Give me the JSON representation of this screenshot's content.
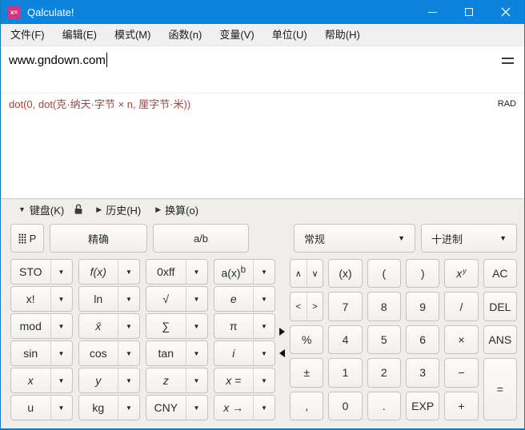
{
  "window": {
    "title": "Qalculate!",
    "titlebar_color": "#0c83dc",
    "border_color": "#1879c0"
  },
  "icons": {
    "app_glyph": "x=",
    "dropdown": "▼",
    "triangle_down": "▼",
    "triangle_right": "▶"
  },
  "menu": {
    "items": [
      {
        "n": "file",
        "label": "文件(F)"
      },
      {
        "n": "edit",
        "label": "编辑(E)"
      },
      {
        "n": "mode",
        "label": "模式(M)"
      },
      {
        "n": "functions",
        "label": "函数(n)"
      },
      {
        "n": "variables",
        "label": "变量(V)"
      },
      {
        "n": "units",
        "label": "单位(U)"
      },
      {
        "n": "help",
        "label": "帮助(H)"
      }
    ]
  },
  "input": {
    "value": "www.gndown.com"
  },
  "status": {
    "parsed": "dot(0, dot(克·纳天·字节 × n, 厘字节·米))",
    "parsed_color": "#a9423d",
    "angle_mode": "RAD"
  },
  "panels": {
    "keyboard": "键盘(K)",
    "history": "历史(H)",
    "convert": "换算(o)"
  },
  "toolbar": {
    "programming": "P",
    "exact": "精确",
    "fraction": "a/b",
    "display_mode": "常规",
    "number_base": "十进制"
  },
  "keypad": {
    "left": [
      [
        {
          "n": "sto",
          "l": "STO"
        },
        {
          "n": "f-of-x",
          "l": "f(x)",
          "i": 1
        },
        {
          "n": "0xff",
          "l": "0xff"
        },
        {
          "n": "a-x-pow-b",
          "l": "a(x)",
          "sup": "b"
        }
      ],
      [
        {
          "n": "factorial",
          "l": "x!"
        },
        {
          "n": "ln",
          "l": "ln"
        },
        {
          "n": "sqrt",
          "l": "√"
        },
        {
          "n": "euler-e",
          "l": "e",
          "i": 1
        }
      ],
      [
        {
          "n": "mod",
          "l": "mod"
        },
        {
          "n": "mean",
          "l": "x̄",
          "i": 1
        },
        {
          "n": "sum",
          "l": "∑"
        },
        {
          "n": "pi",
          "l": "π"
        }
      ],
      [
        {
          "n": "sin",
          "l": "sin"
        },
        {
          "n": "cos",
          "l": "cos"
        },
        {
          "n": "tan",
          "l": "tan"
        },
        {
          "n": "imaginary-i",
          "l": "i",
          "i": 1
        }
      ],
      [
        {
          "n": "var-x",
          "l": "x",
          "i": 1
        },
        {
          "n": "var-y",
          "l": "y",
          "i": 1
        },
        {
          "n": "var-z",
          "l": "z",
          "i": 1
        },
        {
          "n": "x-equals",
          "l": "x =",
          "i": 1
        }
      ],
      [
        {
          "n": "unit-u",
          "l": "u"
        },
        {
          "n": "unit-kg",
          "l": "kg"
        },
        {
          "n": "currency-cny",
          "l": "CNY"
        },
        {
          "n": "x-to",
          "l": "x →",
          "i": 1
        }
      ]
    ],
    "nav": {
      "up": "∧",
      "down": "∨",
      "left": "<",
      "right": ">"
    },
    "right": [
      [
        {
          "nav": "ud"
        },
        {
          "n": "smart-parentheses",
          "l": "(x)"
        },
        {
          "n": "open-paren",
          "l": "("
        },
        {
          "n": "close-paren",
          "l": ")"
        },
        {
          "n": "x-pow-y",
          "l": "x",
          "sup": "y",
          "i": 1
        },
        {
          "n": "ac",
          "l": "AC"
        }
      ],
      [
        {
          "nav": "lr"
        },
        {
          "n": "digit-7",
          "l": "7"
        },
        {
          "n": "digit-8",
          "l": "8"
        },
        {
          "n": "digit-9",
          "l": "9"
        },
        {
          "n": "divide",
          "l": "/"
        },
        {
          "n": "del",
          "l": "DEL"
        }
      ],
      [
        {
          "n": "percent",
          "l": "%"
        },
        {
          "n": "digit-4",
          "l": "4"
        },
        {
          "n": "digit-5",
          "l": "5"
        },
        {
          "n": "digit-6",
          "l": "6"
        },
        {
          "n": "multiply",
          "l": "×"
        },
        {
          "n": "ans",
          "l": "ANS"
        }
      ],
      [
        {
          "n": "plus-minus",
          "l": "±"
        },
        {
          "n": "digit-1",
          "l": "1"
        },
        {
          "n": "digit-2",
          "l": "2"
        },
        {
          "n": "digit-3",
          "l": "3"
        },
        {
          "n": "minus",
          "l": "−"
        },
        {
          "n": "equals",
          "l": "=",
          "tall": 1
        }
      ],
      [
        {
          "n": "comma",
          "l": ","
        },
        {
          "n": "digit-0",
          "l": "0"
        },
        {
          "n": "decimal-point",
          "l": "."
        },
        {
          "n": "exp",
          "l": "EXP"
        },
        {
          "n": "plus",
          "l": "+"
        }
      ]
    ]
  }
}
